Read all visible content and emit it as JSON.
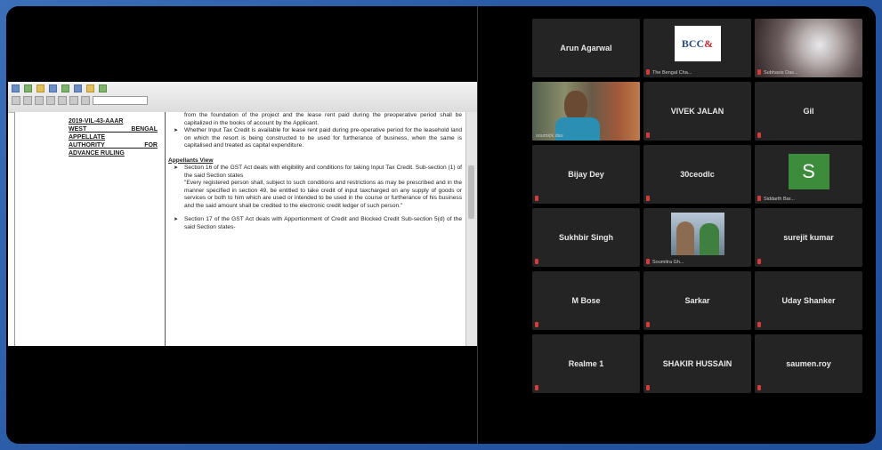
{
  "document": {
    "left_col": [
      "2019-VIL-43-AAAR",
      "WEST BENGAL",
      "APPELLATE",
      "AUTHORITY FOR",
      "ADVANCE RULING"
    ],
    "right_col": {
      "p1": "from the foundation of the project and the lease rent paid during the preoperative period shall be capitalized in the books of account by the Applicant.",
      "b1": "Whether Input Tax Credit is available for lease rent paid during pre-operative period for the leasehold land on which the resort is being constructed to be used for furtherance of business, when the same is capitalised and treated as capital expenditure.",
      "heading": "Appellants View",
      "b2": "Section 16 of the GST Act deals with eligibility and conditions for taking Input Tax Credit. Sub-section (1) of the said Section states",
      "quote": "\"Every registered person shall, subject to such conditions and restrictions as may be prescribed and in the manner specified in section 49, be entitled to take credit of input taxcharged on any supply of goods or services or both to him which are used or intended to be used in the course or furtherance of his business and the said amount shall be credited to the electronic credit ledger of such person.\"",
      "b3": "Section 17 of the GST Act deals with Apportionment of Credit and Blocked Credit Sub-section 5(d) of the said Section states-"
    }
  },
  "participants": {
    "t0": {
      "name": "Arun Agarwal"
    },
    "t1": {
      "sub": "The Bengal Cha..."
    },
    "t2": {
      "sub": "Subhasis Das..."
    },
    "t3": {
      "sub": "soumick das"
    },
    "t4": {
      "name": "VIVEK JALAN"
    },
    "t5": {
      "name": "Gil"
    },
    "t6": {
      "name": "Bijay Dey"
    },
    "t7": {
      "name": "30ceodlc"
    },
    "t8": {
      "sub": "Siddarth Bar...",
      "avatar": "S"
    },
    "t9": {
      "name": "Sukhbir Singh"
    },
    "t10": {
      "sub": "Soumitra Gh..."
    },
    "t11": {
      "name": "surejit kumar"
    },
    "t12": {
      "name": "M Bose"
    },
    "t13": {
      "name": "Sarkar"
    },
    "t14": {
      "name": "Uday Shanker"
    },
    "t15": {
      "name": "Realme 1"
    },
    "t16": {
      "name": "SHAKIR HUSSAIN"
    },
    "t17": {
      "name": "saumen.roy"
    }
  },
  "logo_bcc": "BCC",
  "logo_amp": "&",
  "colors": {
    "active_border": "#e6dc3a",
    "mic_muted": "#d63a3a",
    "tile_bg": "#242424"
  }
}
